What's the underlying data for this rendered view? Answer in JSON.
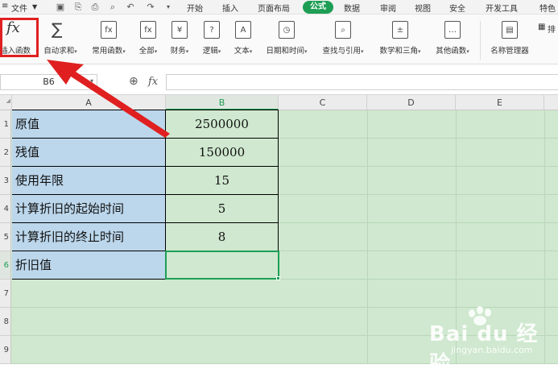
{
  "menubar": {
    "file": "文件",
    "tabs": [
      "开始",
      "插入",
      "页面布局",
      "公式",
      "数据",
      "审阅",
      "视图",
      "安全",
      "开发工具",
      "特色"
    ],
    "active_tab": "公式"
  },
  "ribbon": {
    "insert_function": "插入函数",
    "autosum": "自动求和",
    "common": "常用函数",
    "all": "全部",
    "finance": "财务",
    "logic": "逻辑",
    "text": "文本",
    "datetime": "日期和时间",
    "lookup": "查找与引用",
    "math": "数学和三角",
    "other": "其他函数",
    "name_manager": "名称管理器",
    "more_partial": "排"
  },
  "formula_bar": {
    "cell_ref": "B6",
    "fx_label": "fx",
    "value": ""
  },
  "sheet": {
    "columns": [
      "A",
      "B",
      "C",
      "D",
      "E"
    ],
    "active_column": "B",
    "rows": [
      "1",
      "2",
      "3",
      "4",
      "5",
      "6",
      "7",
      "8",
      "9"
    ],
    "active_row": "6",
    "labels": [
      "原值",
      "残值",
      "使用年限",
      "计算折旧的起始时间",
      "计算折旧的终止时间",
      "折旧值"
    ],
    "values": [
      "2500000",
      "150000",
      "15",
      "5",
      "8",
      ""
    ]
  },
  "watermark": {
    "brand": "Bai du 经验",
    "site": "jingyan.baidu.com"
  },
  "colors": {
    "accent": "#1e9e55",
    "label_fill": "#bcd7ec",
    "grid_fill": "#cfe8cf",
    "annotation": "#e02020"
  }
}
